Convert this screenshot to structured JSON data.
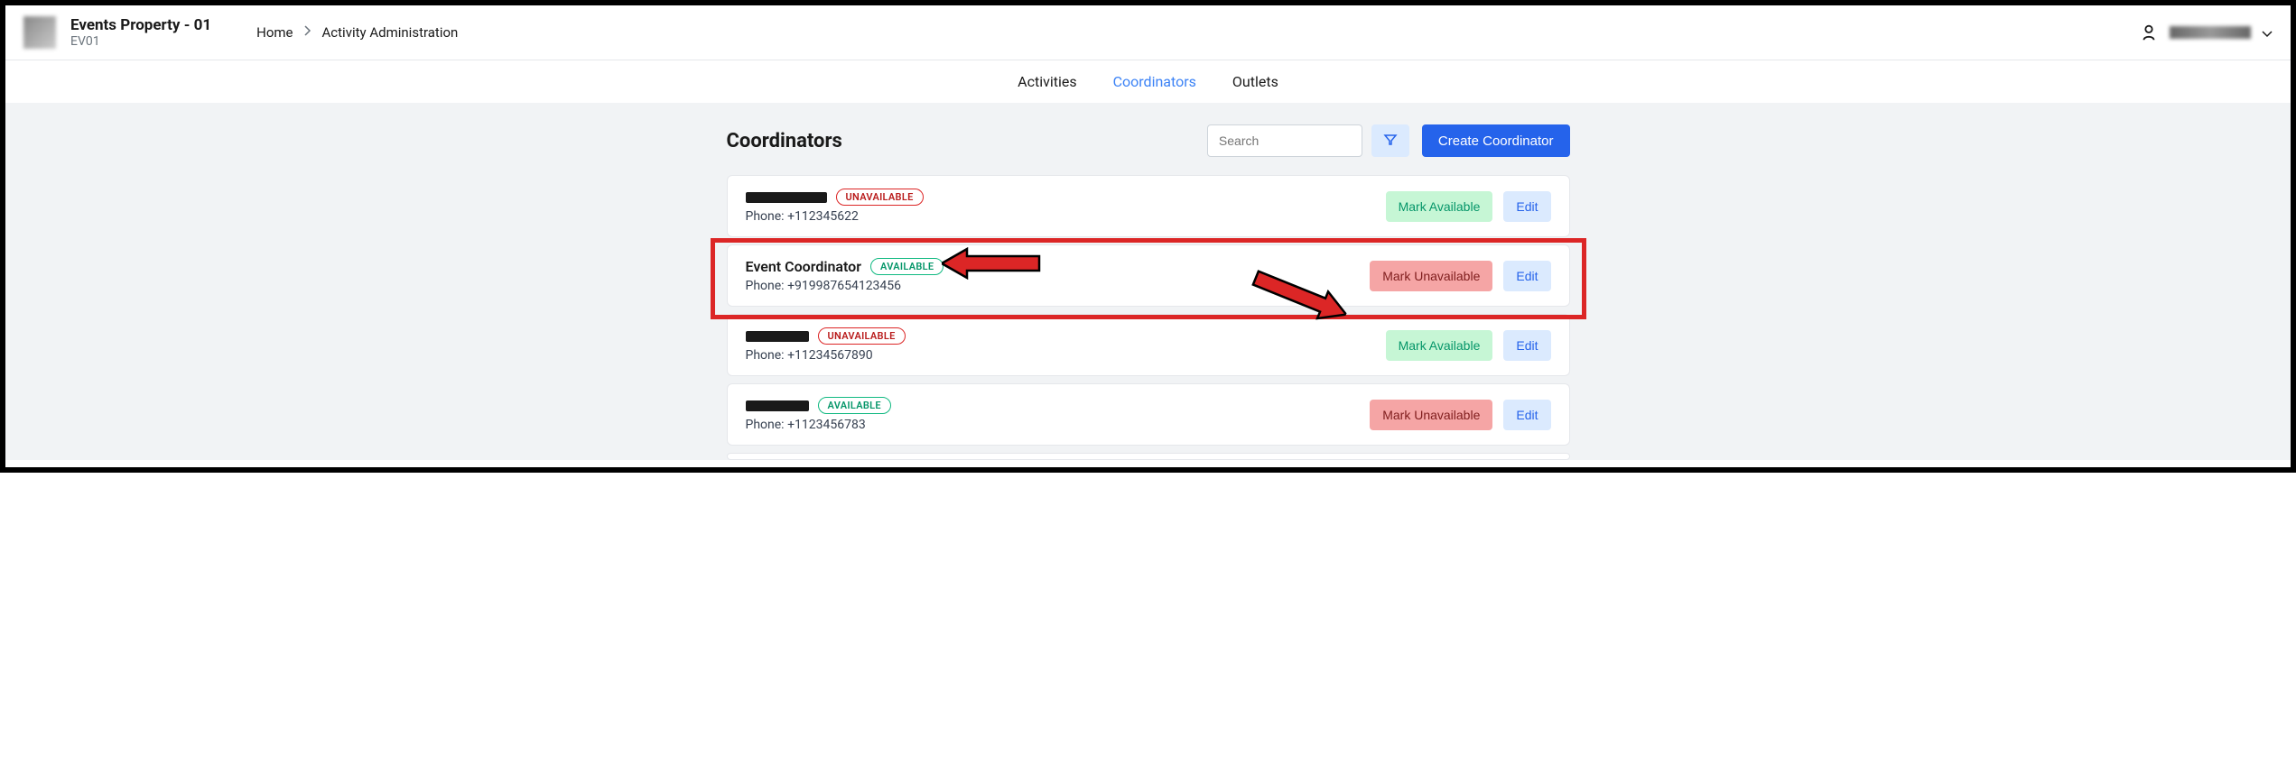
{
  "header": {
    "property_name": "Events Property - 01",
    "property_code": "EV01",
    "breadcrumb": {
      "home": "Home",
      "current": "Activity Administration"
    }
  },
  "tabs": {
    "activities": "Activities",
    "coordinators": "Coordinators",
    "outlets": "Outlets"
  },
  "page": {
    "title": "Coordinators",
    "search_placeholder": "Search",
    "create_label": "Create Coordinator"
  },
  "status_labels": {
    "available": "AVAILABLE",
    "unavailable": "UNAVAILABLE"
  },
  "action_labels": {
    "mark_available": "Mark Available",
    "mark_unavailable": "Mark Unavailable",
    "edit": "Edit"
  },
  "phone_label": "Phone:",
  "coordinators": [
    {
      "phone": "+112345622",
      "status": "unavailable",
      "redacted": true,
      "highlight": false
    },
    {
      "name": "Event Coordinator",
      "phone": "+919987654123456",
      "status": "available",
      "redacted": false,
      "highlight": true
    },
    {
      "phone": "+11234567890",
      "status": "unavailable",
      "redacted": true,
      "highlight": false
    },
    {
      "phone": "+1123456783",
      "status": "available",
      "redacted": true,
      "highlight": false
    }
  ]
}
